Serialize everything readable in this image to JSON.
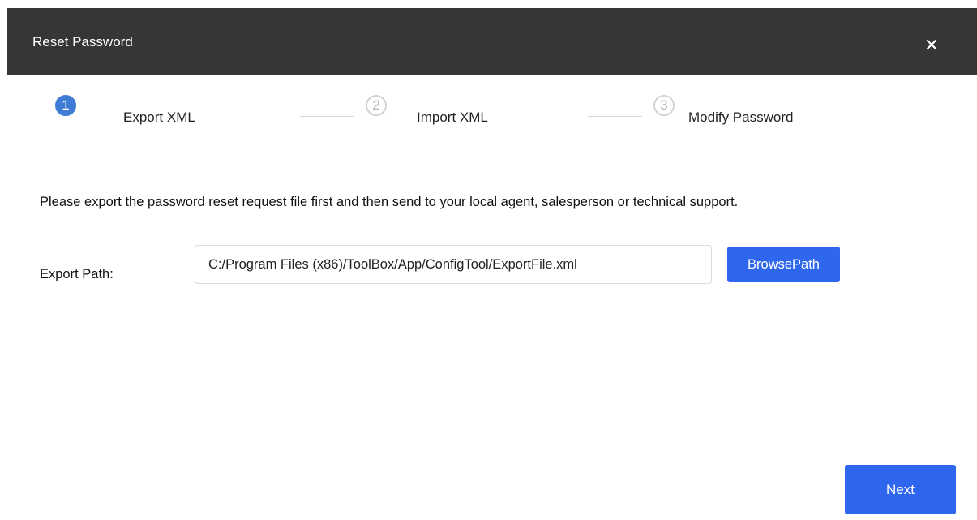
{
  "dialog": {
    "title": "Reset Password",
    "close_icon": "close-icon",
    "colors": {
      "titlebar": "#363636",
      "accent": "#2f66ee",
      "active_step": "#3f7cd6",
      "inactive_step": "#b5b5b5"
    }
  },
  "steps": [
    {
      "number": "1",
      "label": "Export XML",
      "state": "active"
    },
    {
      "number": "2",
      "label": "Import XML",
      "state": "inactive"
    },
    {
      "number": "3",
      "label": "Modify Password",
      "state": "inactive"
    }
  ],
  "content": {
    "instructions": "Please export the password reset request file first and then send to your local agent, salesperson or technical support.",
    "export_path_label": "Export Path:",
    "export_path_value": "C:/Program Files (x86)/ToolBox/App/ConfigTool/ExportFile.xml",
    "browse_label": "BrowsePath"
  },
  "footer": {
    "next_label": "Next"
  }
}
